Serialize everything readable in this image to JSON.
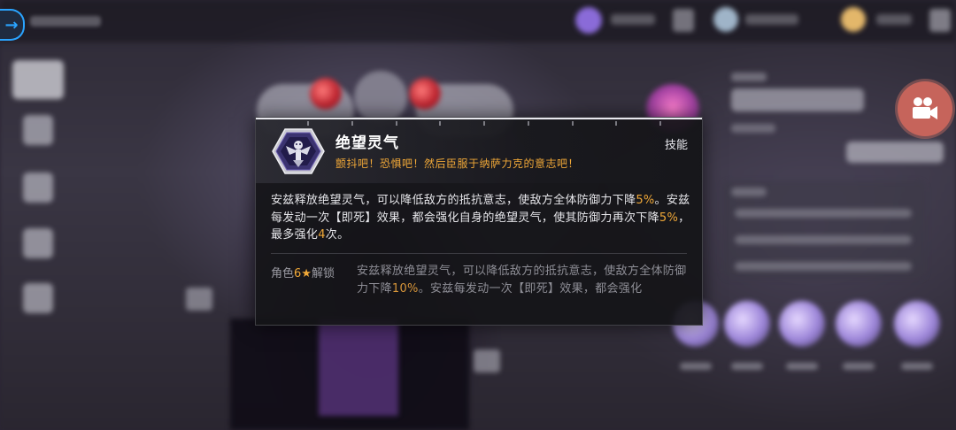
{
  "skill": {
    "name": "绝望灵气",
    "quote": "颤抖吧！恐惧吧！然后臣服于纳萨力克的意志吧！",
    "type": "技能",
    "desc_p1": "安兹释放绝望灵气，可以降低敌方的抵抗意志，使敌方全体防御力下降",
    "desc_v1": "5%",
    "desc_p2": "。安兹每发动一次【即死】效果，都会强化自身的绝望灵气，使其防御力再次下降",
    "desc_v2": "5%",
    "desc_p3": "，最多强化",
    "desc_v3": "4",
    "desc_p4": "次。",
    "unlock": {
      "prefix": "角色",
      "stars": "6",
      "star_icon": "★",
      "suffix": "解锁",
      "desc_p1": "安兹释放绝望灵气，可以降低敌方的抵抗意志，使敌方全体防御力下降",
      "desc_v1": "10%",
      "desc_p2": "。安兹每发动一次【即死】效果，都会强化"
    }
  },
  "colors": {
    "highlight": "#f0a838",
    "back_button": "#2aa4ff",
    "record_button": "#c6645b"
  },
  "icons": {
    "back": "arrow-right-circle",
    "record": "video-camera",
    "skill": "skeleton-crest"
  }
}
